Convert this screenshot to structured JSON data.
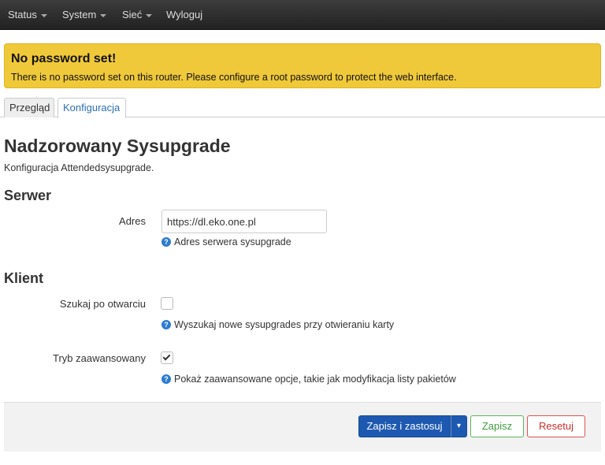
{
  "nav": {
    "items": [
      {
        "label": "Status",
        "dropdown": true
      },
      {
        "label": "System",
        "dropdown": true
      },
      {
        "label": "Sieć",
        "dropdown": true
      },
      {
        "label": "Wyloguj",
        "dropdown": false
      }
    ]
  },
  "alert": {
    "title": "No password set!",
    "text": "There is no password set on this router. Please configure a root password to protect the web interface."
  },
  "tabs": [
    {
      "label": "Przegląd",
      "active": false
    },
    {
      "label": "Konfiguracja",
      "active": true
    }
  ],
  "page": {
    "title": "Nadzorowany Sysupgrade",
    "description": "Konfiguracja Attendedsysupgrade."
  },
  "server": {
    "title": "Serwer",
    "address_label": "Adres",
    "address_value": "https://dl.eko.one.pl",
    "address_hint": "Adres serwera sysupgrade"
  },
  "client": {
    "title": "Klient",
    "search_label": "Szukaj po otwarciu",
    "search_checked": false,
    "search_hint": "Wyszukaj nowe sysupgrades przy otwieraniu karty",
    "advanced_label": "Tryb zaawansowany",
    "advanced_checked": true,
    "advanced_hint": "Pokaż zaawansowane opcje, takie jak modyfikacja listy pakietów"
  },
  "help_icon_glyph": "?",
  "footer": {
    "apply_label": "Zapisz i zastosuj",
    "apply_dropdown_glyph": "▾",
    "save_label": "Zapisz",
    "reset_label": "Resetuj"
  },
  "colors": {
    "navbar": "#2b2b2b",
    "alert": "#f0c93a",
    "primary": "#1d59b0",
    "success": "#3f9c3f",
    "danger": "#c9302c",
    "help": "#2c7bd0"
  }
}
